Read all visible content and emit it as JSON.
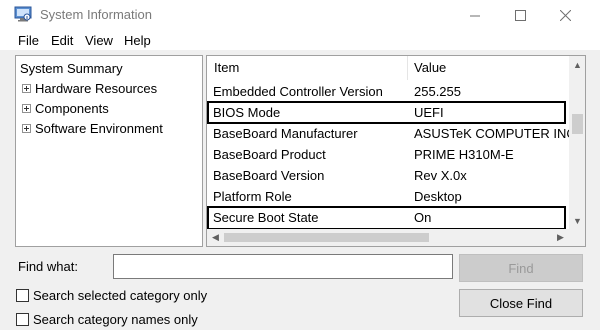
{
  "window": {
    "title": "System Information",
    "controls": {
      "minimize": "—",
      "maximize": "☐",
      "close": "✕"
    }
  },
  "menu": [
    "File",
    "Edit",
    "View",
    "Help"
  ],
  "tree": {
    "root": "System Summary",
    "children": [
      "Hardware Resources",
      "Components",
      "Software Environment"
    ]
  },
  "details": {
    "columns": {
      "item": "Item",
      "value": "Value"
    },
    "rows": [
      {
        "item": "Embedded Controller Version",
        "value": "255.255"
      },
      {
        "item": "BIOS Mode",
        "value": "UEFI",
        "highlighted": true
      },
      {
        "item": "BaseBoard Manufacturer",
        "value": "ASUSTeK COMPUTER INC."
      },
      {
        "item": "BaseBoard Product",
        "value": "PRIME H310M-E"
      },
      {
        "item": "BaseBoard Version",
        "value": "Rev X.0x"
      },
      {
        "item": "Platform Role",
        "value": "Desktop"
      },
      {
        "item": "Secure Boot State",
        "value": "On",
        "highlighted": true
      }
    ]
  },
  "search": {
    "find_label": "Find what:",
    "find_value": "",
    "find_button": "Find",
    "close_find_button": "Close Find",
    "option_selected_category": "Search selected category only",
    "option_category_names": "Search category names only"
  },
  "icons": {
    "app": "system-information-icon",
    "expander": "plus-box-icon"
  }
}
